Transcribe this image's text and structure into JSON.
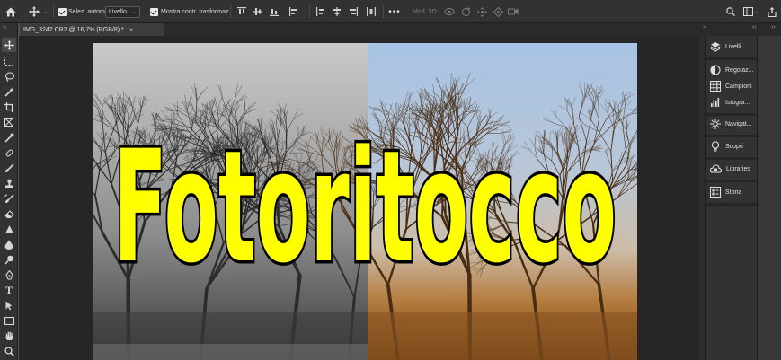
{
  "options_bar": {
    "auto_select_label": "Selez. autom.",
    "auto_select_target": "Livello",
    "show_transform_label": "Mostra contr. trasformaz.",
    "mode_3d_label": "Mod. 3D:"
  },
  "document_tab": {
    "title": "IMG_3242.CR2 @ 16,7% (RGB/8) *"
  },
  "canvas": {
    "headline": "Fotoritocco"
  },
  "panels": [
    {
      "label": "Livelli",
      "icon": "layers-icon"
    },
    {
      "label": "Regolaz...",
      "icon": "adjustments-icon"
    },
    {
      "label": "Campioni",
      "icon": "swatches-icon"
    },
    {
      "label": "Istogra...",
      "icon": "histogram-icon"
    },
    {
      "label": "Navigat...",
      "icon": "navigator-icon"
    },
    {
      "label": "Scopri",
      "icon": "discover-icon"
    },
    {
      "label": "Libraries",
      "icon": "libraries-icon"
    },
    {
      "label": "Storia",
      "icon": "history-icon"
    }
  ],
  "colors": {
    "headline_fill": "#ffff00",
    "headline_stroke": "#000000",
    "app_chrome": "#323232"
  }
}
